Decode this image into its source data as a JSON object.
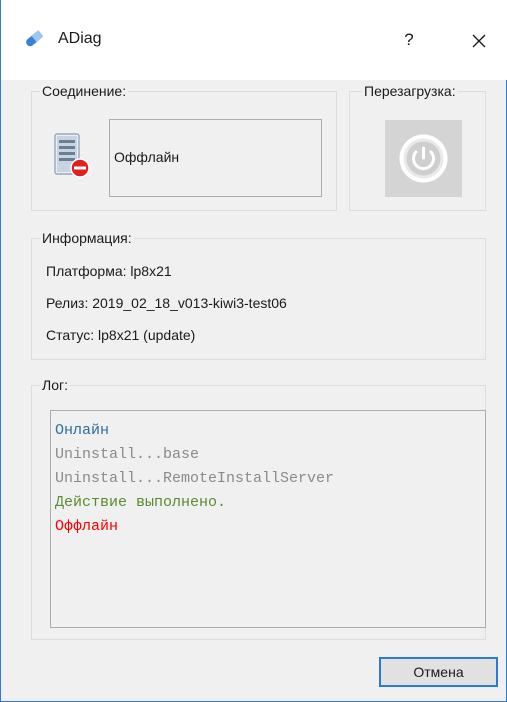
{
  "window": {
    "title": "ADiag",
    "help_label": "?",
    "close_icon": "close-icon",
    "app_icon": "adiag-app-icon"
  },
  "connection": {
    "legend": "Соединение:",
    "status": "Оффлайн",
    "icon": "server-offline-icon"
  },
  "reboot": {
    "legend": "Перезагрузка:",
    "icon": "power-icon"
  },
  "info": {
    "legend": "Информация:",
    "platform": "Платформа: lp8x21",
    "release": "Релиз: 2019_02_18_v013-kiwi3-test06",
    "status": "Статус: lp8x21 (update)"
  },
  "log": {
    "legend": "Лог:",
    "lines": [
      {
        "text": "Онлайн",
        "color": "#2e6f9e"
      },
      {
        "text": "Uninstall...base",
        "color": "#8a8a8a"
      },
      {
        "text": "Uninstall...RemoteInstallServer",
        "color": "#8a8a8a"
      },
      {
        "text": "Действие выполнено.",
        "color": "#5a8a2e"
      },
      {
        "text": "Оффлайн",
        "color": "#ff0000"
      }
    ]
  },
  "buttons": {
    "cancel": "Отмена"
  },
  "colors": {
    "accent": "#2b7bd6",
    "offline": "#ff0000"
  }
}
